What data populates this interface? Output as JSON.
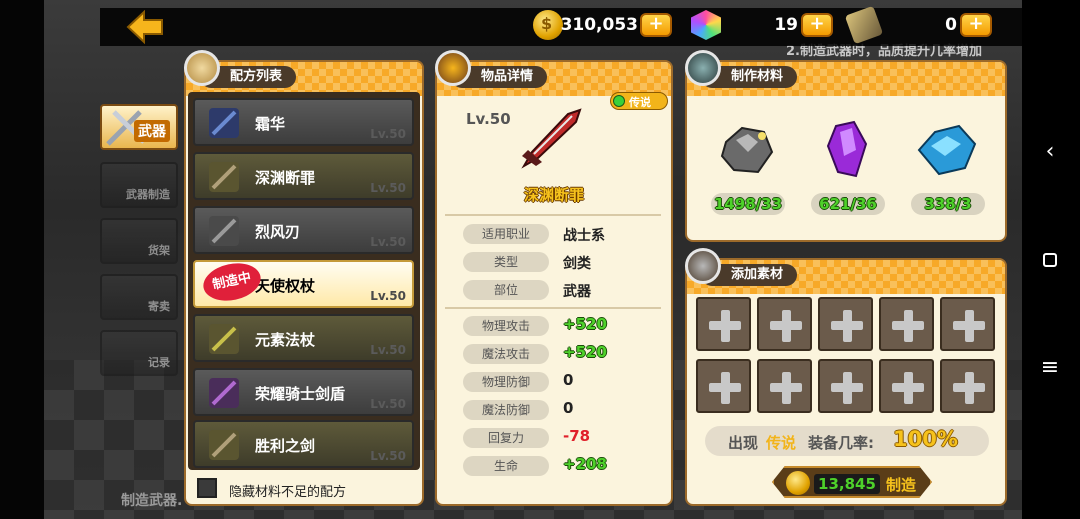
{
  "resources": {
    "gold": "310,053",
    "gems": "19",
    "tickets": "0",
    "plus_label": "+"
  },
  "side_tabs": [
    {
      "label": "武器",
      "active": true
    },
    {
      "label": "武器制造",
      "active": false
    },
    {
      "label": "货架",
      "active": false
    },
    {
      "label": "寄卖",
      "active": false
    },
    {
      "label": "记录",
      "active": false
    }
  ],
  "background_text": {
    "top_hint": "2.制造武器时，品质提升几率增加",
    "bottom_left": "制造武器."
  },
  "recipe_panel": {
    "title": "配方列表",
    "recipes": [
      {
        "name": "霜华",
        "level": "Lv.50",
        "selected": false
      },
      {
        "name": "深渊断罪",
        "level": "Lv.50",
        "selected": false
      },
      {
        "name": "烈风刃",
        "level": "Lv.50",
        "selected": false
      },
      {
        "name": "天使权杖",
        "level": "Lv.50",
        "selected": true,
        "stamp": "制造中"
      },
      {
        "name": "元素法杖",
        "level": "Lv.50",
        "selected": false
      },
      {
        "name": "荣耀骑士剑盾",
        "level": "Lv.50",
        "selected": false
      },
      {
        "name": "胜利之剑",
        "level": "Lv.50",
        "selected": false
      }
    ],
    "hide_insufficient_label": "隐藏材料不足的配方"
  },
  "item_panel": {
    "title": "物品详情",
    "rarity": "传说",
    "level": "Lv.50",
    "item_name": "深渊断罪",
    "info": [
      {
        "label": "适用职业",
        "value": "战士系"
      },
      {
        "label": "类型",
        "value": "剑类"
      },
      {
        "label": "部位",
        "value": "武器"
      }
    ],
    "stats": [
      {
        "label": "物理攻击",
        "value": "+520",
        "color": "green"
      },
      {
        "label": "魔法攻击",
        "value": "+520",
        "color": "green"
      },
      {
        "label": "物理防御",
        "value": "0",
        "color": "dark"
      },
      {
        "label": "魔法防御",
        "value": "0",
        "color": "dark"
      },
      {
        "label": "回复力",
        "value": "-78",
        "color": "red"
      },
      {
        "label": "生命",
        "value": "+208",
        "color": "green"
      }
    ]
  },
  "materials_panel": {
    "title": "制作材料",
    "materials": [
      {
        "icon": "iron-ore-icon",
        "count": "1498/33"
      },
      {
        "icon": "purple-crystal-icon",
        "count": "621/36"
      },
      {
        "icon": "blue-crystal-icon",
        "count": "338/3"
      }
    ]
  },
  "add_panel": {
    "title": "添加素材",
    "slot_count": 10,
    "chance_prefix": "出现",
    "chance_quality": "传说",
    "chance_middle": "装备几率:",
    "chance_value": "100%",
    "cost": "13,845",
    "craft_label": "制造"
  },
  "colors": {
    "accent_orange": "#f7a928",
    "panel_bg": "#fbf4dd",
    "stat_green": "#4ed12a",
    "stat_red": "#e0202a",
    "chance_gold": "#f2b41a"
  }
}
